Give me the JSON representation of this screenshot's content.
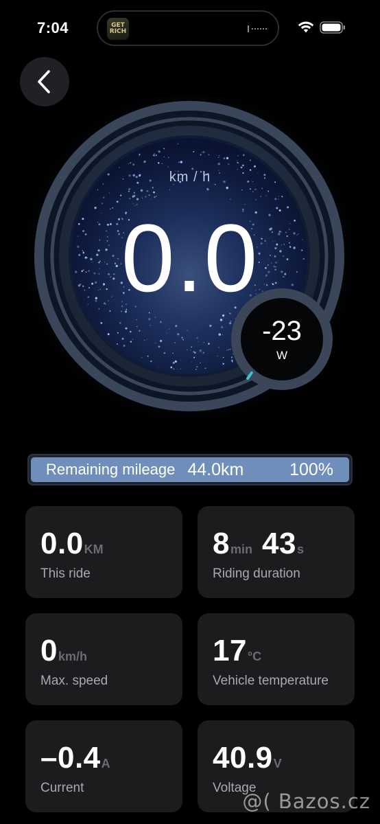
{
  "status_bar": {
    "time": "7:04",
    "island_app_label": "GET\nRICH"
  },
  "gauge": {
    "speed": "0.0",
    "speed_unit": "km / h",
    "power": "-23",
    "power_unit": "W"
  },
  "mileage": {
    "label": "Remaining mileage",
    "distance": "44.0km",
    "percent": "100%",
    "fill_fraction": 1.0
  },
  "cards": [
    {
      "value": "0.0",
      "unit": "KM",
      "label": "This ride"
    },
    {
      "value": "8",
      "unit": "min",
      "value2": "43",
      "unit2": "s",
      "label": "Riding duration"
    },
    {
      "value": "0",
      "unit": "km/h",
      "label": "Max. speed"
    },
    {
      "value": "17",
      "unit": "°C",
      "label": "Vehicle temperature"
    },
    {
      "value": "–0.4",
      "unit": "A",
      "label": "Current"
    },
    {
      "value": "40.9",
      "unit": "V",
      "label": "Voltage"
    }
  ],
  "watermark": "@( Bazos.cz",
  "colors": {
    "background": "#000000",
    "card": "#1c1c1e",
    "mileage_fill": "#6f8fba",
    "power_tick": "#3ec6c0"
  }
}
